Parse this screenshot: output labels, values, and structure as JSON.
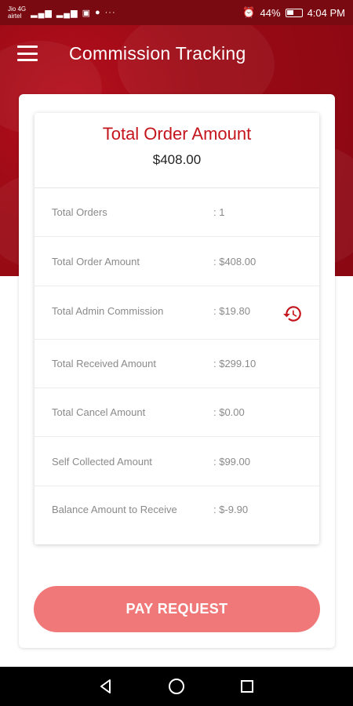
{
  "status_bar": {
    "carrier_line1": "Jio 4G",
    "carrier_line2": "airtel",
    "battery": "44%",
    "time": "4:04 PM"
  },
  "app_bar": {
    "title": "Commission Tracking",
    "menu_icon": "hamburger-menu-icon"
  },
  "summary": {
    "title": "Total Order Amount",
    "amount": "$408.00"
  },
  "rows": [
    {
      "label": "Total Orders",
      "value": ": 1"
    },
    {
      "label": "Total Order Amount",
      "value": ": $408.00"
    },
    {
      "label": "Total Admin Commission",
      "value": ": $19.80",
      "icon": "history-icon"
    },
    {
      "label": "Total Received Amount",
      "value": ": $299.10"
    },
    {
      "label": "Total Cancel Amount",
      "value": ": $0.00"
    },
    {
      "label": "Self Collected Amount",
      "value": ": $99.00"
    },
    {
      "label": "Balance Amount to Receive",
      "value": ": $-9.90"
    }
  ],
  "pay_button": {
    "label": "PAY REQUEST"
  },
  "colors": {
    "header": "#9b0a15",
    "accent": "#c4141c",
    "button": "#f07878"
  },
  "nav": {
    "back": "back-icon",
    "home": "home-icon",
    "recents": "recents-icon"
  }
}
